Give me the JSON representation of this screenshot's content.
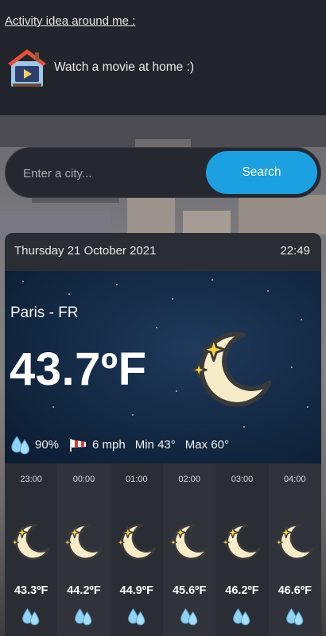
{
  "activity": {
    "heading": "Activity idea around me :",
    "icon": "house-movie-icon",
    "text": "Watch a movie at home :)"
  },
  "search": {
    "placeholder": "Enter a city...",
    "button_label": "Search"
  },
  "weather": {
    "date": "Thursday 21 October 2021",
    "time": "22:49",
    "city": "Paris - FR",
    "temperature": "43.7ºF",
    "condition_icon": "crescent-moon-stars-icon",
    "humidity": "90%",
    "wind": "6 mph",
    "min": "Min 43°",
    "max": "Max 60°"
  },
  "hourly": [
    {
      "time": "23:00",
      "temp": "43.3ºF",
      "icon": "crescent-moon-stars-icon"
    },
    {
      "time": "00:00",
      "temp": "44.2ºF",
      "icon": "crescent-moon-stars-icon"
    },
    {
      "time": "01:00",
      "temp": "44.9ºF",
      "icon": "crescent-moon-stars-icon"
    },
    {
      "time": "02:00",
      "temp": "45.6ºF",
      "icon": "crescent-moon-stars-icon"
    },
    {
      "time": "03:00",
      "temp": "46.2ºF",
      "icon": "crescent-moon-stars-icon"
    },
    {
      "time": "04:00",
      "temp": "46.6ºF",
      "icon": "crescent-moon-stars-icon"
    }
  ],
  "colors": {
    "background": "#23252c",
    "card": "#2b2d34",
    "accent": "#1ba1e2",
    "night_sky": "#142a45"
  }
}
